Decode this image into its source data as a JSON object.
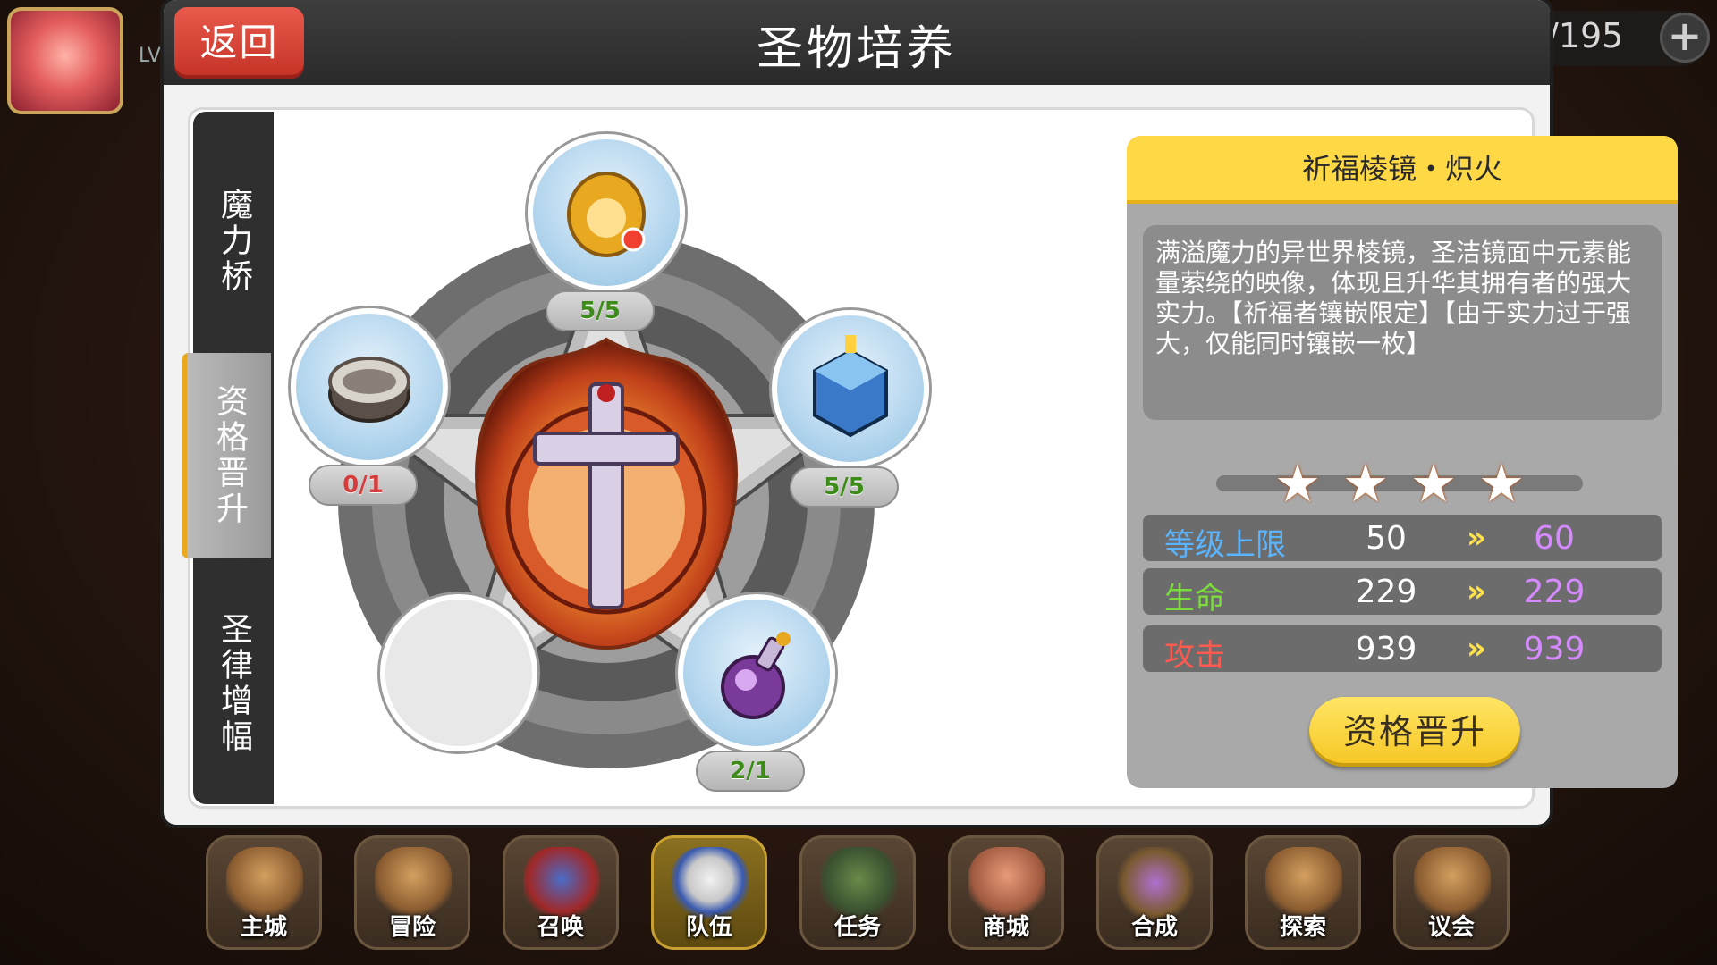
{
  "hud": {
    "level_prefix": "LV",
    "resource_text": "/195"
  },
  "dialog": {
    "title": "圣物培养",
    "back_label": "返回"
  },
  "sidebar": {
    "tabs": [
      {
        "label": "魔力桥",
        "active": false
      },
      {
        "label": "资格晋升",
        "active": true
      },
      {
        "label": "圣律增幅",
        "active": false
      }
    ]
  },
  "relic_slots": {
    "top": {
      "icon": "golden-amulet-icon",
      "count": "5/5",
      "status": "green"
    },
    "left": {
      "icon": "silver-ring-icon",
      "count": "0/1",
      "status": "red"
    },
    "right": {
      "icon": "blue-lantern-cube-icon",
      "count": "5/5",
      "status": "green"
    },
    "bottom_right": {
      "icon": "purple-potion-icon",
      "count": "2/1",
      "status": "green"
    },
    "bottom_left": {
      "icon": "empty-slot",
      "count": null
    }
  },
  "relic_center": {
    "icon": "flaming-cross-emblem-icon"
  },
  "info": {
    "name": "祈福棱镜・炽火",
    "description": "满溢魔力的异世界棱镜，圣洁镜面中元素能量萦绕的映像，体现且升华其拥有者的强大实力。【祈福者镶嵌限定】【由于实力过于强大，仅能同时镶嵌一枚】",
    "stars": 4,
    "stats": [
      {
        "label": "等级上限",
        "from": "50",
        "to": "60",
        "label_color": "#5ab4ff"
      },
      {
        "label": "生命",
        "from": "229",
        "to": "229",
        "label_color": "#7cdc3c"
      },
      {
        "label": "攻击",
        "from": "939",
        "to": "939",
        "label_color": "#ff5a50"
      }
    ],
    "arrow": "»",
    "upgrade_label": "资格晋升"
  },
  "bottom_nav": [
    {
      "label": "主城",
      "icon": "crown-icon",
      "active": false
    },
    {
      "label": "冒险",
      "icon": "crossed-weapons-icon",
      "active": false
    },
    {
      "label": "召唤",
      "icon": "summon-card-icon",
      "active": false
    },
    {
      "label": "队伍",
      "icon": "winged-crest-icon",
      "active": true
    },
    {
      "label": "任务",
      "icon": "quest-book-icon",
      "active": false
    },
    {
      "label": "商城",
      "icon": "shop-tree-icon",
      "active": false
    },
    {
      "label": "合成",
      "icon": "alchemy-flask-icon",
      "active": false
    },
    {
      "label": "探索",
      "icon": "shovel-rope-icon",
      "active": false
    },
    {
      "label": "议会",
      "icon": "council-crown-icon",
      "active": false
    }
  ]
}
